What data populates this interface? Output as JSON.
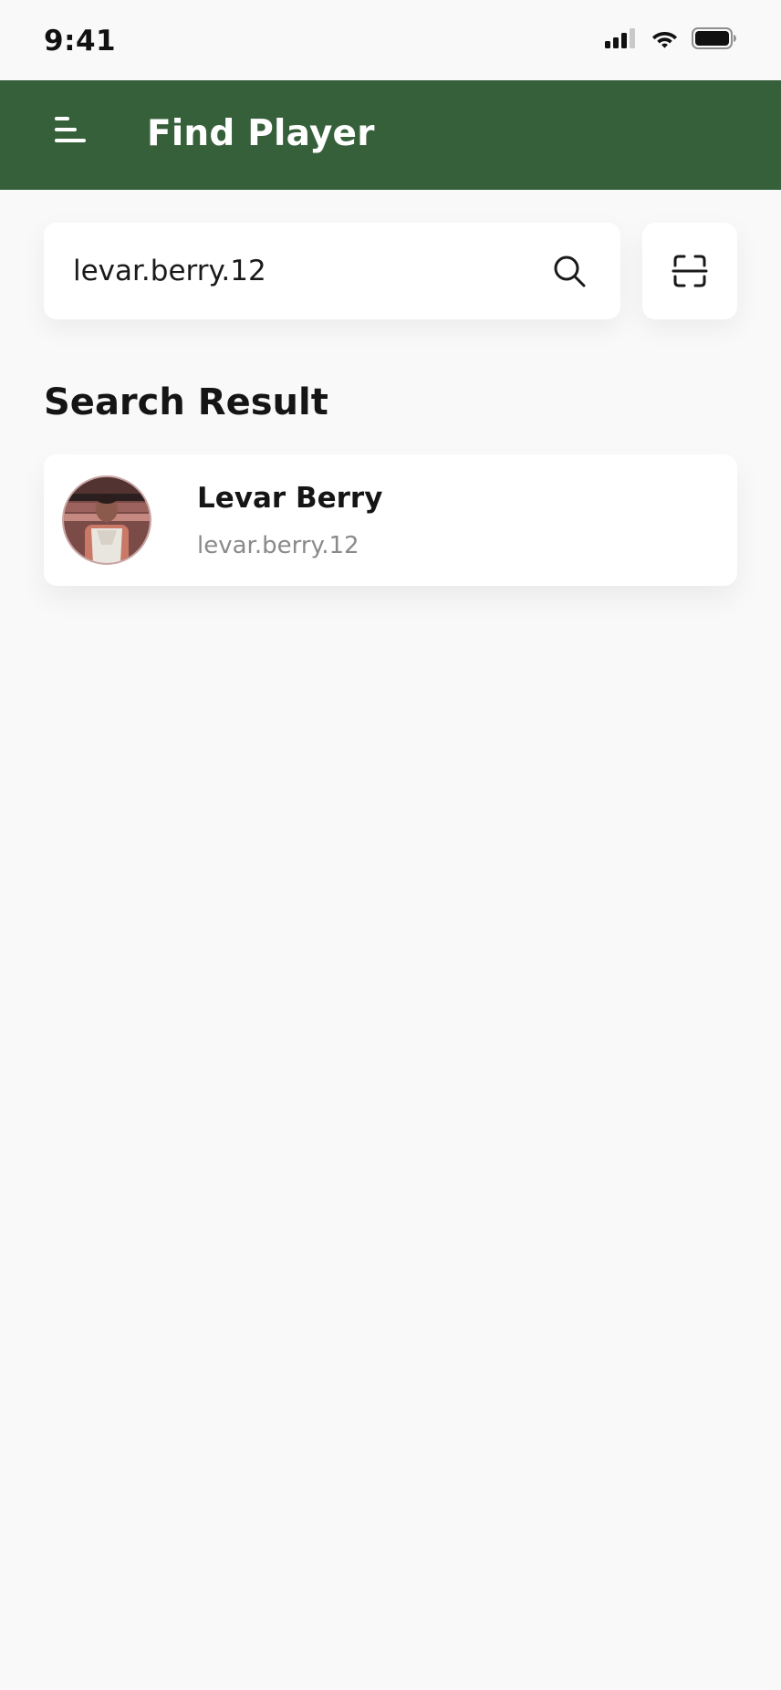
{
  "status_bar": {
    "time": "9:41",
    "signal_icon": "cellular-signal-icon",
    "wifi_icon": "wifi-icon",
    "battery_icon": "battery-icon"
  },
  "header": {
    "title": "Find Player",
    "menu_icon": "menu-icon",
    "background_color": "#36603a"
  },
  "search": {
    "value": "levar.berry.12",
    "search_icon": "search-icon",
    "scan_icon": "qr-scan-icon"
  },
  "results": {
    "section_title": "Search Result",
    "items": [
      {
        "name": "Levar Berry",
        "handle": "levar.berry.12"
      }
    ]
  }
}
